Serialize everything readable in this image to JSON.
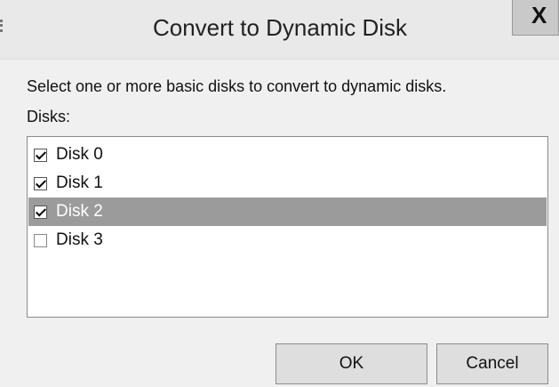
{
  "window": {
    "title": "Convert to Dynamic Disk",
    "close_glyph": "X"
  },
  "instruction": "Select one or more basic disks to convert to dynamic disks.",
  "disks_label": "Disks:",
  "disks": [
    {
      "label": "Disk 0",
      "checked": true,
      "selected": false
    },
    {
      "label": "Disk 1",
      "checked": true,
      "selected": false
    },
    {
      "label": "Disk 2",
      "checked": true,
      "selected": true
    },
    {
      "label": "Disk 3",
      "checked": false,
      "selected": false
    }
  ],
  "buttons": {
    "ok": "OK",
    "cancel": "Cancel"
  },
  "colors": {
    "selection": "#9b9b9b",
    "background": "#f0f0f0"
  }
}
